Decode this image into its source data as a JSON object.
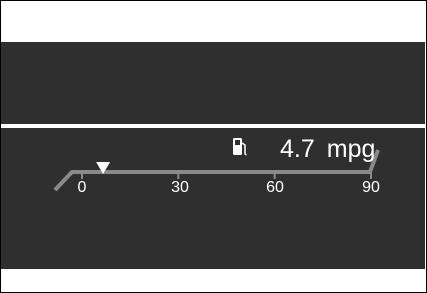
{
  "colors": {
    "panel": "#2f2f2f",
    "bar": "#8a8a8a",
    "text": "#ffffff"
  },
  "fuel_economy": {
    "icon": "fuel-pump-icon",
    "value": "4.7",
    "unit": "mpg",
    "scale_min": 0,
    "scale_max": 90,
    "indicator_value": 4.7
  },
  "scale_ticks": [
    {
      "value": 0,
      "label": "0"
    },
    {
      "value": 30,
      "label": "30"
    },
    {
      "value": 60,
      "label": "60"
    },
    {
      "value": 90,
      "label": "90"
    }
  ]
}
